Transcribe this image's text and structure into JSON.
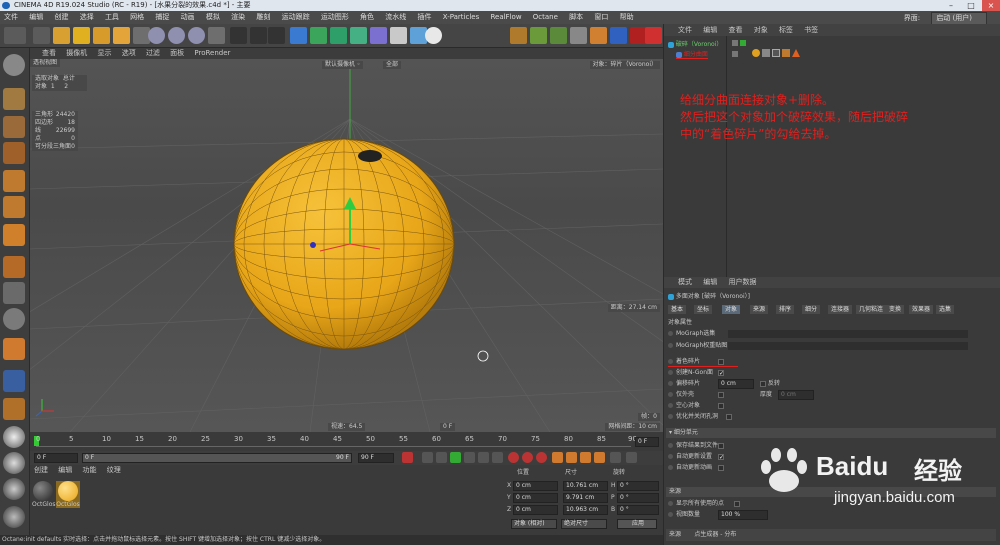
{
  "window": {
    "title": "CINEMA 4D R19.024 Studio (RC - R19) - [水果分裂的效果.c4d *] - 主要"
  },
  "menu": [
    "文件",
    "编辑",
    "创建",
    "选择",
    "工具",
    "网格",
    "捕捉",
    "动画",
    "模拟",
    "渲染",
    "雕刻",
    "运动跟踪",
    "运动图形",
    "角色",
    "流水线",
    "插件",
    "X-Particles",
    "RealFlow",
    "Octane",
    "脚本",
    "窗口",
    "帮助"
  ],
  "layout": {
    "label": "界面:",
    "value": "启动 (用户)"
  },
  "viewport_menu": [
    "查看",
    "摄像机",
    "显示",
    "选项",
    "过滤",
    "面板",
    "ProRender"
  ],
  "viewport": {
    "view_name": "透视视图",
    "camera": "默认摄像机 ◦",
    "hud_center2": "全部",
    "hud_right": "对象：碎片（Voronoi）",
    "hud_select": [
      "选取对象",
      "总计"
    ],
    "hud_objects": {
      "label": "对象",
      "selected": "1",
      "total": "2"
    },
    "stats": [
      [
        "三角形",
        "24420"
      ],
      [
        "四边形",
        "18"
      ],
      [
        "线",
        "22699"
      ],
      [
        "点",
        "0"
      ],
      [
        "可分段三角面",
        "0"
      ]
    ],
    "grid_distance": "网格间距：10 cm",
    "fps": "帧：0",
    "focal": "视速：64.5",
    "frame_center": "0 F",
    "distance": "距离：27.14 cm"
  },
  "timeline": {
    "ticks": [
      "0",
      "5",
      "10",
      "15",
      "20",
      "25",
      "30",
      "35",
      "40",
      "45",
      "50",
      "55",
      "60",
      "65",
      "70",
      "75",
      "80",
      "85",
      "90"
    ],
    "current": "0 F"
  },
  "playbar": {
    "start": "0 F",
    "from": "0 F",
    "to": "90 F",
    "end": "90 F"
  },
  "materials": {
    "menu": [
      "创建",
      "编辑",
      "功能",
      "纹理"
    ],
    "items": [
      {
        "name": "OctGlos",
        "color": "#222222"
      },
      {
        "name": "OctGlos",
        "color": "#e8a619"
      }
    ]
  },
  "coords": {
    "headers": [
      "位置",
      "尺寸",
      "旋转"
    ],
    "rows": [
      {
        "axis": "X",
        "pos": "0 cm",
        "size": "10.761 cm",
        "rot_axis": "H",
        "rot": "0 °"
      },
      {
        "axis": "Y",
        "pos": "0 cm",
        "size": "9.791 cm",
        "rot_axis": "P",
        "rot": "0 °"
      },
      {
        "axis": "Z",
        "pos": "0 cm",
        "size": "10.963 cm",
        "rot_axis": "B",
        "rot": "0 °"
      }
    ],
    "mode": "对象 (相对)",
    "size_mode": "绝对尺寸",
    "apply": "应用"
  },
  "status": "Octane:init defaults   实时选择：点击并拖动鼠标选择元素。按住 SHIFT 键增加选择对象；按住 CTRL 键减少选择对象。",
  "object_manager": {
    "menu": [
      "文件",
      "编辑",
      "查看",
      "对象",
      "标签",
      "书签"
    ],
    "objects": [
      {
        "name": "破碎（Voronoi）",
        "color": "#69d36b"
      },
      {
        "name": "细分曲面",
        "color": "#e0201e"
      }
    ]
  },
  "annotation": [
    "给细分曲面连接对象+删除。",
    "然后把这个对象加个破碎效果，随后把破碎",
    "中的“着色碎片”的勾给去掉。"
  ],
  "attributes": {
    "menu": [
      "模式",
      "编辑",
      "用户数据"
    ],
    "title": "多面对象 [破碎（Voronoi）]",
    "tabs": [
      "基本",
      "坐标",
      "对象",
      "来源",
      "排序",
      "细分",
      "连接器",
      "几何粘连",
      "变换",
      "效果器",
      "选集"
    ],
    "section": "对象属性",
    "links": [
      "MoGraph选集",
      "MoGraph权重贴图"
    ],
    "options": [
      {
        "label": "着色碎片",
        "checked": false
      },
      {
        "label": "创建N-Gon面",
        "checked": true
      },
      {
        "label": "偏移碎片",
        "value": "0 cm",
        "extra": "反转"
      },
      {
        "label": "仅外壳",
        "checked": false,
        "extra": "厚度",
        "extra_value": "0 cm"
      },
      {
        "label": "空心对象",
        "checked": false
      },
      {
        "label": "优化并关闭孔洞",
        "checked": false
      }
    ],
    "section2": "▾ 细分单元",
    "opts2": [
      {
        "label": "保存结果到文件",
        "checked": false
      },
      {
        "label": "自动更新设置",
        "checked": true
      },
      {
        "label": "自动更新动画",
        "checked": false
      }
    ],
    "source_section": "来源",
    "opts3": [
      {
        "label": "显示所有使用的点",
        "checked": false
      },
      {
        "label": "视图数量",
        "value": "100 %"
      }
    ],
    "footer": [
      "来源",
      "点生成器 - 分布"
    ]
  },
  "watermark": {
    "brand": "Baidu",
    "brand_cn": "经验",
    "url": "jingyan.baidu.com"
  }
}
